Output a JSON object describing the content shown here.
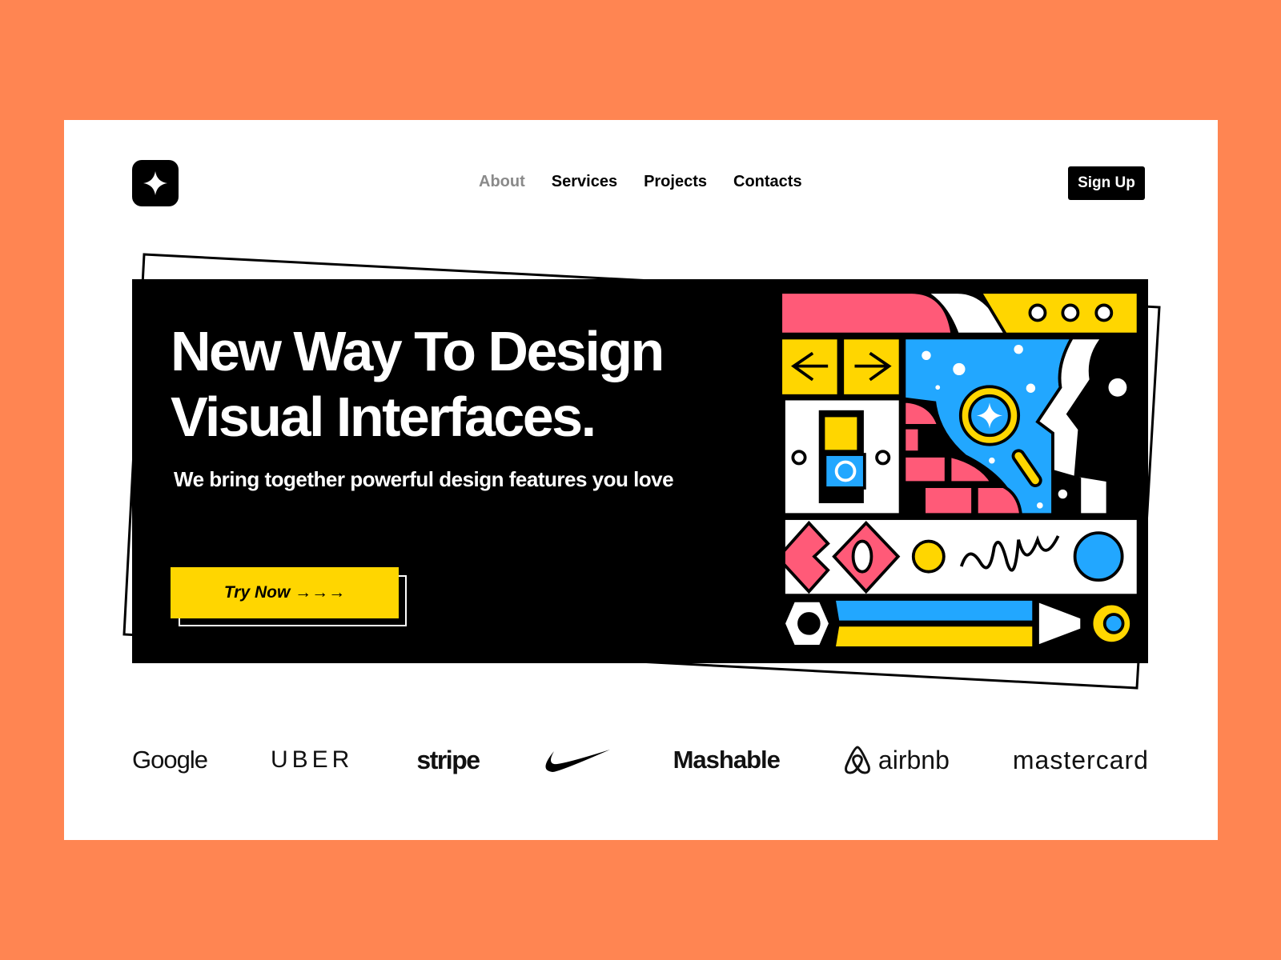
{
  "nav": {
    "logo_icon": "sparkle-icon",
    "items": [
      {
        "label": "About",
        "active": true
      },
      {
        "label": "Services"
      },
      {
        "label": "Projects"
      },
      {
        "label": "Contacts"
      }
    ],
    "signup": "Sign Up"
  },
  "hero": {
    "title_line1": "New Way To Design",
    "title_line2": "Visual Interfaces.",
    "subtitle": "We bring together powerful design features you love",
    "cta": "Try Now →→→"
  },
  "brands": [
    "Google",
    "UBER",
    "stripe",
    "Nike",
    "Mashable",
    "airbnb",
    "mastercard"
  ],
  "colors": {
    "background": "#FF8552",
    "accent": "#FFD600",
    "pink": "#FF5A78",
    "blue": "#22A7FF"
  }
}
